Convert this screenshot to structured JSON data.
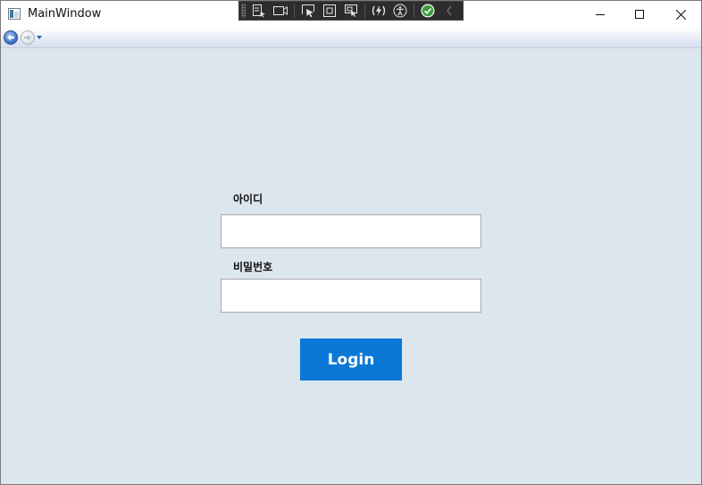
{
  "window": {
    "title": "MainWindow"
  },
  "icons": {
    "app": "window-app-icon",
    "minimize": "minimize-icon",
    "maximize": "maximize-icon",
    "close": "close-icon",
    "back": "back-arrow-icon",
    "forward": "forward-arrow-icon",
    "nav_menu": "chevron-down-icon"
  },
  "debug_toolbar": {
    "items": [
      "go-to-live-visual-tree",
      "select-element",
      "display-layout-adorners",
      "track-focused-element",
      "hot-reload",
      "accessibility-checker",
      "binding-status-ok",
      "collapse-toolbar"
    ]
  },
  "form": {
    "id_label": "아이디",
    "id_value": "",
    "password_label": "비밀번호",
    "password_value": "",
    "login_label": "Login"
  },
  "colors": {
    "client_bg": "#dce6ed",
    "login_button": "#0b78d7",
    "debug_toolbar_bg": "#2d2d30"
  }
}
